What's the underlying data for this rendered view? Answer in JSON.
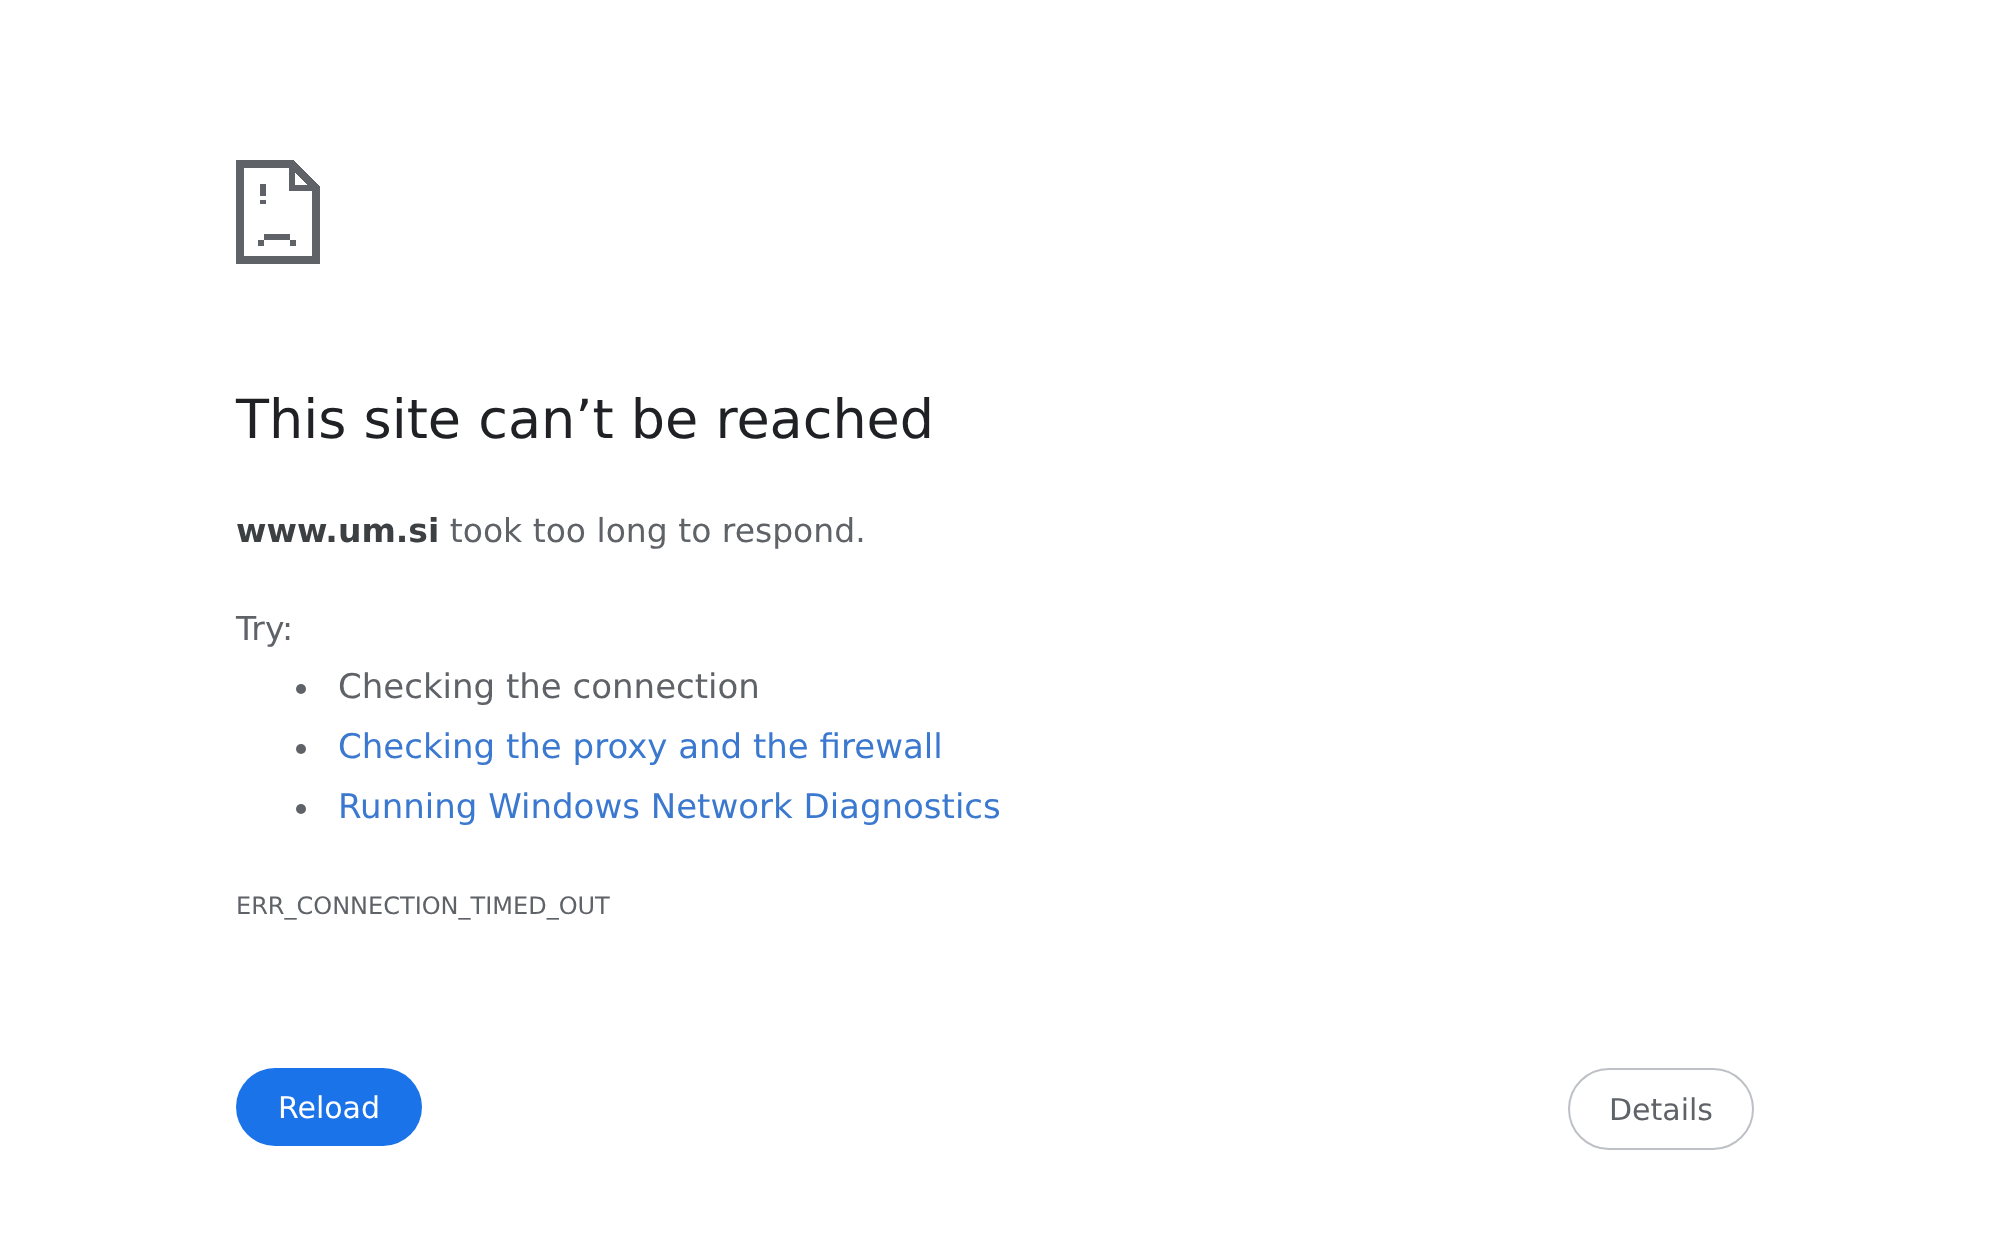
{
  "heading": "This site can’t be reached",
  "summary": "**www.um.si** took too long to respond.",
  "suggestions": {
    "label": "Try:",
    "items": [
      {
        "kind": "text",
        "text": "Checking the connection"
      },
      {
        "kind": "link",
        "text": "Checking the proxy and the firewall"
      },
      {
        "kind": "link",
        "text": "Running Windows Network Diagnostics"
      }
    ]
  },
  "error_code": "ERR_CONNECTION_TIMED_OUT",
  "buttons": [
    {
      "kind": "primary",
      "label": "Reload"
    },
    {
      "kind": "secondary",
      "label": "Details"
    }
  ]
}
